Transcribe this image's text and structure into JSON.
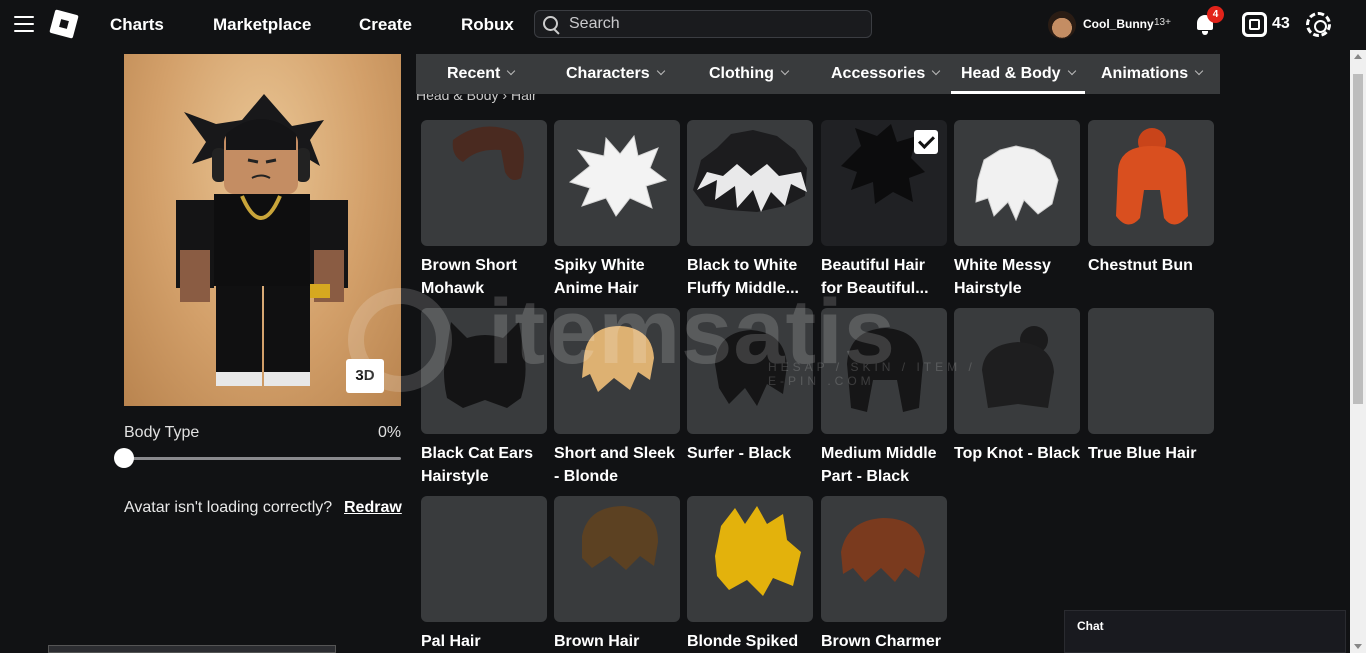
{
  "nav": {
    "links": [
      "Charts",
      "Marketplace",
      "Create",
      "Robux"
    ],
    "search_placeholder": "Search",
    "username": "Cool_Bunny",
    "age_label": "13+",
    "notifications": "4",
    "robux": "43"
  },
  "avatar": {
    "view_toggle": "3D",
    "body_type_label": "Body Type",
    "body_type_value": "0%",
    "body_type_level": 0,
    "redraw_prompt": "Avatar isn't loading correctly?",
    "redraw_link": "Redraw"
  },
  "tabs": [
    {
      "label": "Recent",
      "active": false
    },
    {
      "label": "Characters",
      "active": false
    },
    {
      "label": "Clothing",
      "active": false
    },
    {
      "label": "Accessories",
      "active": false
    },
    {
      "label": "Head & Body",
      "active": true
    },
    {
      "label": "Animations",
      "active": false
    }
  ],
  "breadcrumb": [
    "Head & Body",
    "Hair"
  ],
  "items": [
    {
      "name": "Brown Short Mohawk",
      "selected": false,
      "icon": "brown-mohawk-hair"
    },
    {
      "name": "Spiky White Anime Hair",
      "selected": false,
      "icon": "white-spiky-hair"
    },
    {
      "name": "Black to White Fluffy Middle...",
      "selected": false,
      "icon": "black-white-fluffy-hair"
    },
    {
      "name": "Beautiful Hair for Beautiful...",
      "selected": true,
      "icon": "black-beautiful-hair"
    },
    {
      "name": "White Messy Hairstyle",
      "selected": false,
      "icon": "white-messy-hair"
    },
    {
      "name": "Chestnut Bun",
      "selected": false,
      "icon": "chestnut-bun-hair"
    },
    {
      "name": "Black Cat Ears Hairstyle",
      "selected": false,
      "icon": "black-cat-ears-hair"
    },
    {
      "name": "Short and Sleek - Blonde",
      "selected": false,
      "icon": "blonde-sleek-hair"
    },
    {
      "name": "Surfer - Black",
      "selected": false,
      "icon": "black-surfer-hair"
    },
    {
      "name": "Medium Middle Part - Black",
      "selected": false,
      "icon": "black-middle-part-hair"
    },
    {
      "name": "Top Knot - Black",
      "selected": false,
      "icon": "black-top-knot-hair"
    },
    {
      "name": "True Blue Hair",
      "selected": false,
      "icon": "empty-thumbnail"
    },
    {
      "name": "Pal Hair",
      "selected": false,
      "icon": "empty-thumbnail"
    },
    {
      "name": "Brown Hair",
      "selected": false,
      "icon": "brown-hair"
    },
    {
      "name": "Blonde Spiked",
      "selected": false,
      "icon": "blonde-spiked-hair"
    },
    {
      "name": "Brown Charmer",
      "selected": false,
      "icon": "brown-charmer-hair"
    }
  ],
  "chat": {
    "label": "Chat"
  },
  "watermark": {
    "text": "itemsatis",
    "sub": "HESAP / SKIN / ITEM / E-PIN .COM"
  },
  "colors": {
    "background": "#111214",
    "card": "#393b3d",
    "badge": "#e2231a"
  }
}
